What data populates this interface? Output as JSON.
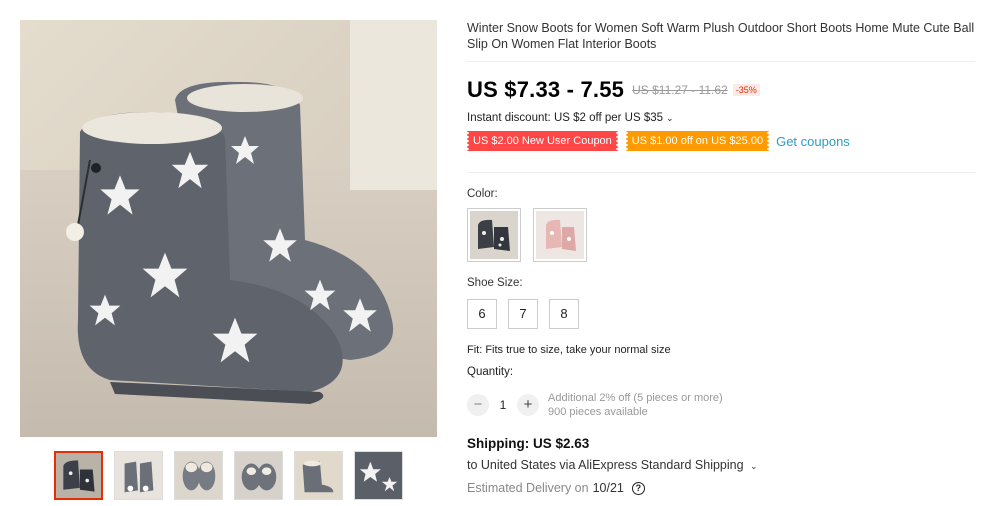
{
  "gallery": {
    "main_image": "boots-grey-stars",
    "thumbnails": [
      "grey-boots-pair",
      "grey-boots-back",
      "grey-boots-top",
      "grey-boots-top-2",
      "grey-boots-angle",
      "grey-boots-closeup"
    ],
    "active_thumbnail": 0
  },
  "product": {
    "title": "Winter Snow Boots for Women Soft Warm Plush Outdoor Short Boots Home Mute Cute Ball Slip On Women Flat Interior Boots",
    "price": "US $7.33 - 7.55",
    "original_price": "US $11.27 - 11.62",
    "discount": "-35%"
  },
  "instant_discount": {
    "text": "Instant discount: US $2 off per US $35",
    "chevron": "⌄"
  },
  "coupons": {
    "items": [
      {
        "label": "US $2.00 New User Coupon",
        "color": "#ff4747"
      },
      {
        "label": "US $1.00 off on US $25.00",
        "color": "#ff9a00"
      }
    ],
    "get_label": "Get coupons"
  },
  "color": {
    "label": "Color:",
    "options": [
      "grey-boots",
      "pink-boots"
    ]
  },
  "size": {
    "label": "Shoe Size:",
    "options": [
      "6",
      "7",
      "8"
    ]
  },
  "fit_text": "Fit: Fits true to size, take your normal size",
  "quantity": {
    "label": "Quantity:",
    "minus": "−",
    "value": "1",
    "plus": "+",
    "note_line1": "Additional 2% off (5 pieces or more)",
    "note_line2": "900 pieces available"
  },
  "shipping": {
    "title": "Shipping: US $2.63",
    "destination": "to United States via AliExpress Standard Shipping",
    "chevron": "⌄",
    "delivery_label": "Estimated Delivery on",
    "delivery_date": "10/21",
    "help": "?"
  },
  "colors": {
    "accent_red": "#e62e04",
    "link_blue": "#2e9cc3"
  }
}
